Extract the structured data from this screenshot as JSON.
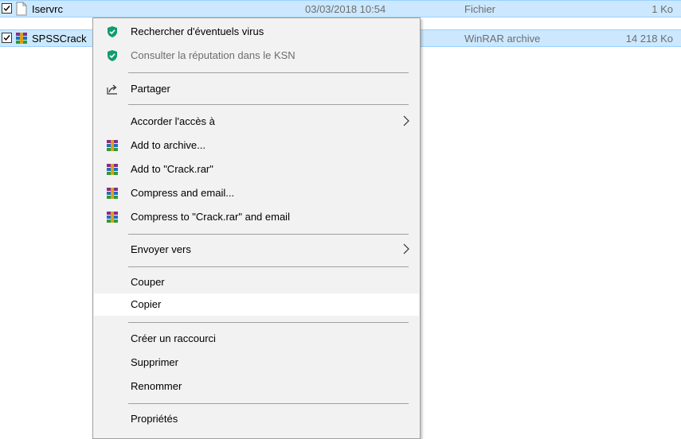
{
  "files": [
    {
      "name": "Iservrc",
      "date": "03/03/2018 10:54",
      "type": "Fichier",
      "size": "1 Ko",
      "checked": true
    },
    {
      "name": "SPSSCrack",
      "date": "",
      "type": "WinRAR archive",
      "size": "14 218 Ko",
      "checked": true
    }
  ],
  "menu": {
    "scan_virus": "Rechercher d'éventuels virus",
    "ksn_reputation": "Consulter la réputation dans le KSN",
    "share": "Partager",
    "grant_access": "Accorder l'accès à",
    "add_to_archive": "Add to archive...",
    "add_to_crack": "Add to \"Crack.rar\"",
    "compress_email": "Compress and email...",
    "compress_crack_email": "Compress to \"Crack.rar\" and email",
    "send_to": "Envoyer vers",
    "cut": "Couper",
    "copy": "Copier",
    "create_shortcut": "Créer un raccourci",
    "delete": "Supprimer",
    "rename": "Renommer",
    "properties": "Propriétés"
  },
  "colors": {
    "selection": "#cce8ff",
    "menu_bg": "#f2f2f2",
    "kaspersky_green": "#0f9d6e"
  }
}
